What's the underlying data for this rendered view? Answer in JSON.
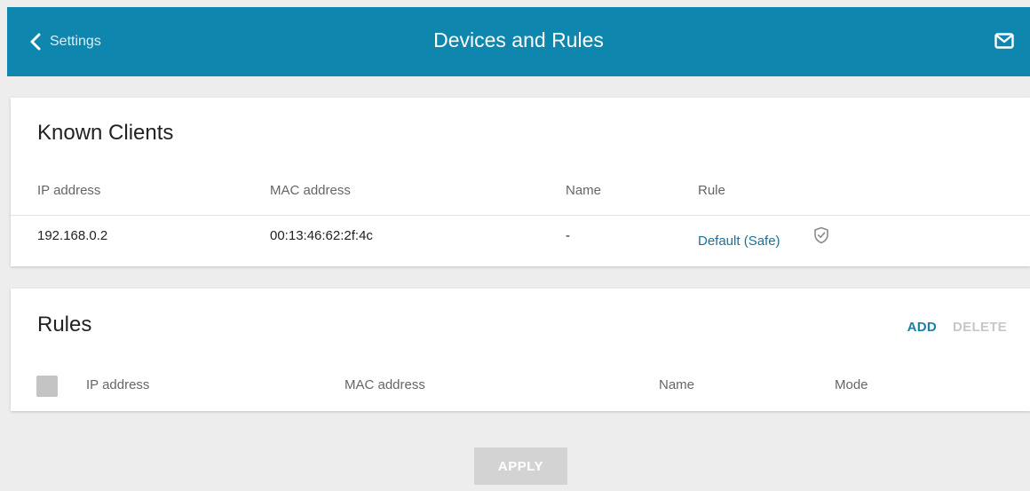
{
  "header": {
    "back_label": "Settings",
    "title": "Devices and Rules",
    "mail_icon": "mail-icon"
  },
  "known_clients": {
    "title": "Known Clients",
    "columns": [
      "IP address",
      "MAC address",
      "Name",
      "Rule"
    ],
    "rows": [
      {
        "ip": "192.168.0.2",
        "mac": "00:13:46:62:2f:4c",
        "name": "-",
        "rule": "Default (Safe)",
        "rule_icon": "shield-check-icon"
      }
    ]
  },
  "rules": {
    "title": "Rules",
    "add_label": "ADD",
    "delete_label": "DELETE",
    "columns": [
      "IP address",
      "MAC address",
      "Name",
      "Mode"
    ]
  },
  "apply_label": "APPLY",
  "colors": {
    "header_bg": "#0f86ad",
    "link": "#1b6f98",
    "accent": "#1b7fa8",
    "disabled": "#c7c7c7"
  }
}
